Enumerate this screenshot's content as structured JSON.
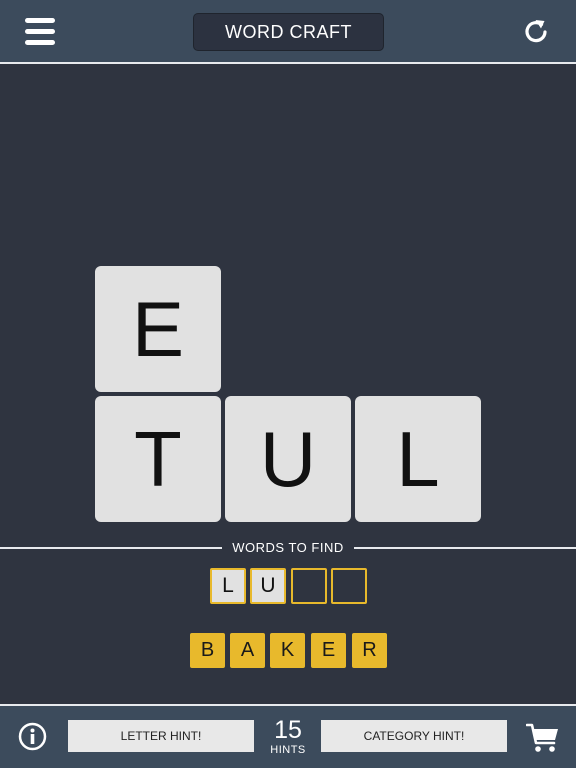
{
  "header": {
    "title": "WORD CRAFT",
    "menu_icon": "hamburger-menu-icon",
    "restart_icon": "restart-icon"
  },
  "board": {
    "tiles": [
      "E",
      "T",
      "U",
      "L"
    ]
  },
  "words_section": {
    "label": "WORDS TO FIND",
    "current_word": [
      "L",
      "U",
      "",
      ""
    ],
    "found_word": [
      "B",
      "A",
      "K",
      "E",
      "R"
    ]
  },
  "footer": {
    "info_icon": "info-icon",
    "letter_hint_label": "LETTER HINT!",
    "hints_count": "15",
    "hints_label": "HINTS",
    "category_hint_label": "CATEGORY HINT!",
    "cart_icon": "shopping-cart-icon"
  },
  "colors": {
    "background": "#2f3440",
    "bar": "#3c4b5c",
    "tile": "#e1e1e1",
    "accent_gold": "#e8b92c"
  }
}
